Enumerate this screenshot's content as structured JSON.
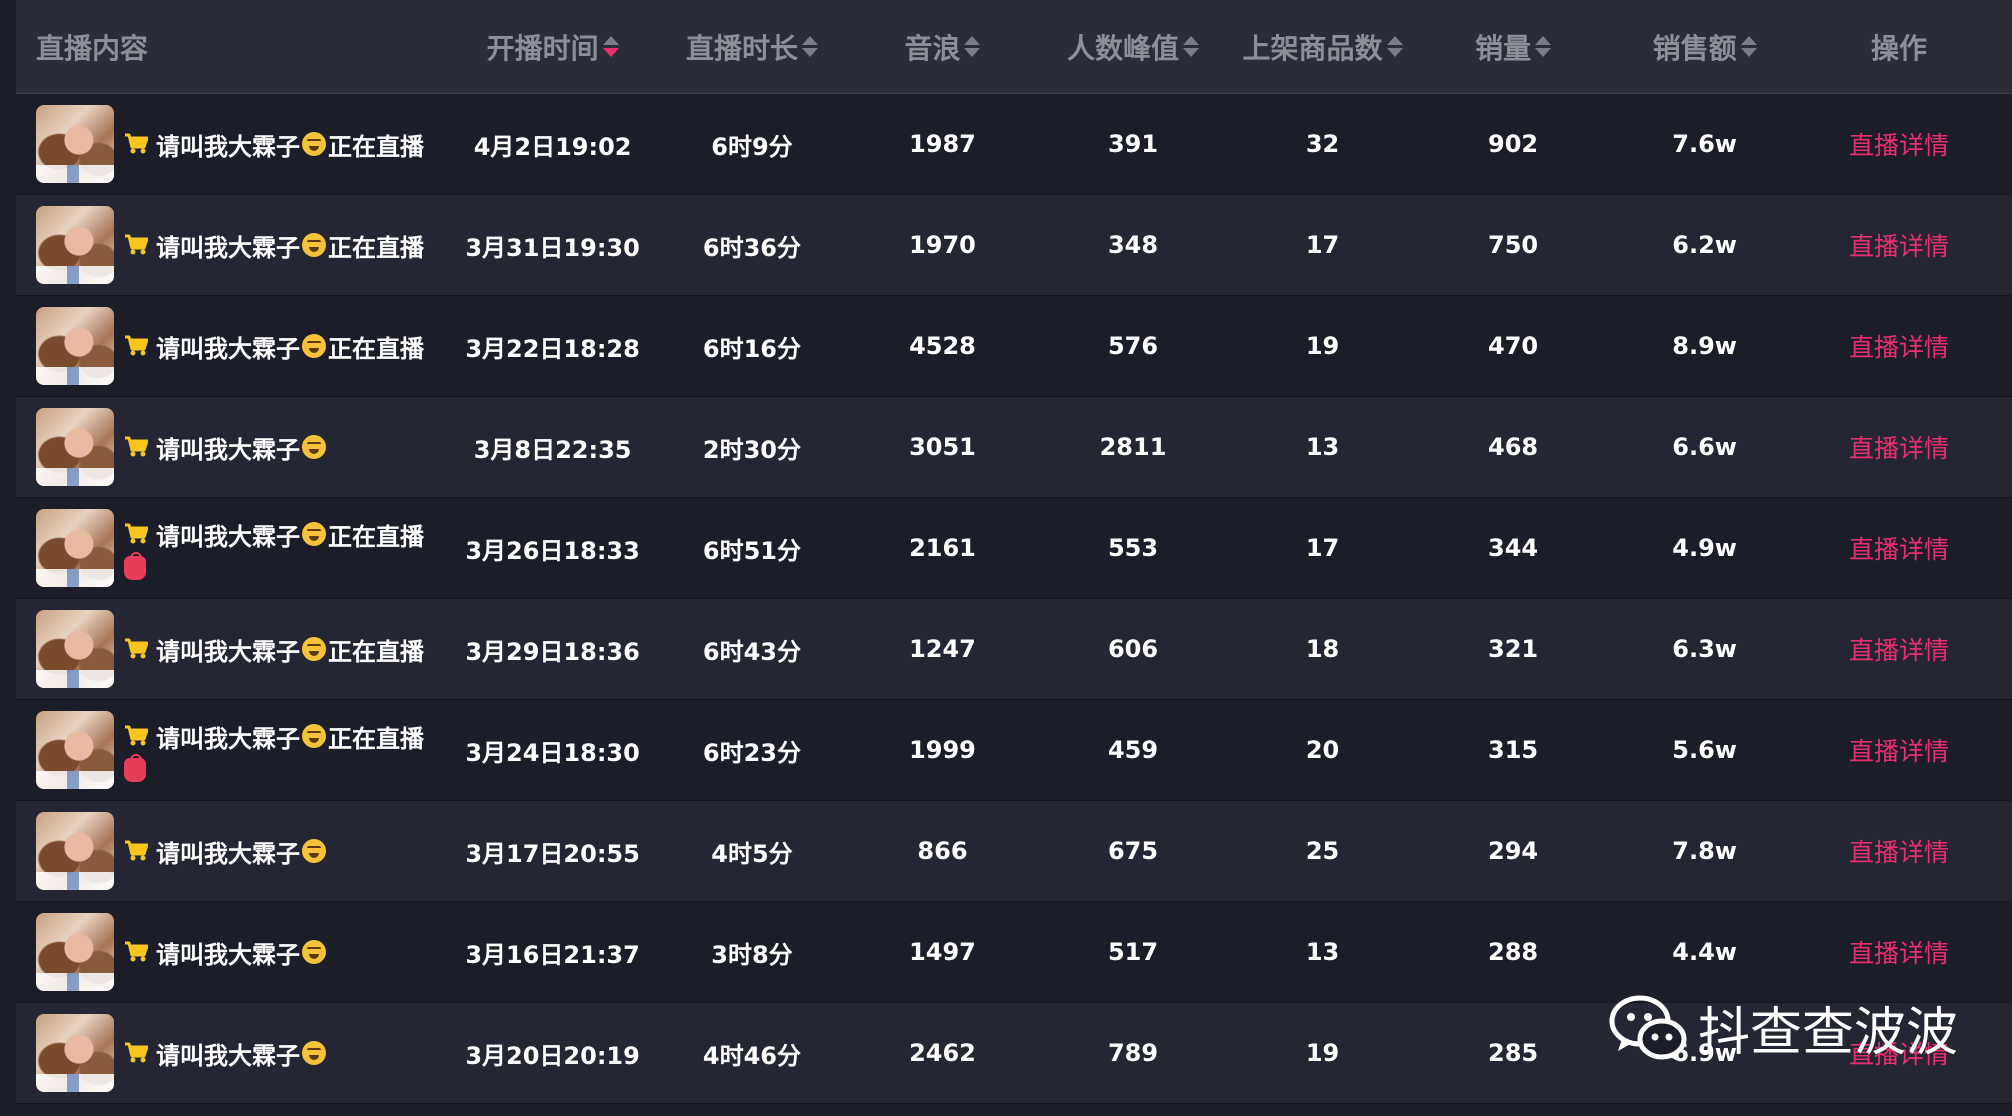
{
  "header": {
    "content": "直播内容",
    "start_time": "开播时间",
    "duration": "直播时长",
    "sound_wave": "音浪",
    "peak_viewers": "人数峰值",
    "products": "上架商品数",
    "sales": "销量",
    "revenue": "销售额",
    "action": "操作"
  },
  "rows": [
    {
      "title": "请叫我大霖子",
      "live": "正在直播",
      "bag": false,
      "time": "4月2日19:02",
      "duration": "6时9分",
      "wave": "1987",
      "peak": "391",
      "products": "32",
      "sales": "902",
      "revenue": "7.6w",
      "action": "直播详情"
    },
    {
      "title": "请叫我大霖子",
      "live": "正在直播",
      "bag": false,
      "time": "3月31日19:30",
      "duration": "6时36分",
      "wave": "1970",
      "peak": "348",
      "products": "17",
      "sales": "750",
      "revenue": "6.2w",
      "action": "直播详情"
    },
    {
      "title": "请叫我大霖子",
      "live": "正在直播",
      "bag": false,
      "time": "3月22日18:28",
      "duration": "6时16分",
      "wave": "4528",
      "peak": "576",
      "products": "19",
      "sales": "470",
      "revenue": "8.9w",
      "action": "直播详情"
    },
    {
      "title": "请叫我大霖子",
      "live": "",
      "bag": false,
      "time": "3月8日22:35",
      "duration": "2时30分",
      "wave": "3051",
      "peak": "2811",
      "products": "13",
      "sales": "468",
      "revenue": "6.6w",
      "action": "直播详情"
    },
    {
      "title": "请叫我大霖子",
      "live": "正在直播",
      "bag": true,
      "time": "3月26日18:33",
      "duration": "6时51分",
      "wave": "2161",
      "peak": "553",
      "products": "17",
      "sales": "344",
      "revenue": "4.9w",
      "action": "直播详情"
    },
    {
      "title": "请叫我大霖子",
      "live": "正在直播",
      "bag": false,
      "time": "3月29日18:36",
      "duration": "6时43分",
      "wave": "1247",
      "peak": "606",
      "products": "18",
      "sales": "321",
      "revenue": "6.3w",
      "action": "直播详情"
    },
    {
      "title": "请叫我大霖子",
      "live": "正在直播",
      "bag": true,
      "time": "3月24日18:30",
      "duration": "6时23分",
      "wave": "1999",
      "peak": "459",
      "products": "20",
      "sales": "315",
      "revenue": "5.6w",
      "action": "直播详情"
    },
    {
      "title": "请叫我大霖子",
      "live": "",
      "bag": false,
      "time": "3月17日20:55",
      "duration": "4时5分",
      "wave": "866",
      "peak": "675",
      "products": "25",
      "sales": "294",
      "revenue": "7.8w",
      "action": "直播详情"
    },
    {
      "title": "请叫我大霖子",
      "live": "",
      "bag": false,
      "time": "3月16日21:37",
      "duration": "3时8分",
      "wave": "1497",
      "peak": "517",
      "products": "13",
      "sales": "288",
      "revenue": "4.4w",
      "action": "直播详情"
    },
    {
      "title": "请叫我大霖子",
      "live": "",
      "bag": false,
      "time": "3月20日20:19",
      "duration": "4时46分",
      "wave": "2462",
      "peak": "789",
      "products": "19",
      "sales": "285",
      "revenue": "6.9w",
      "action": "直播详情"
    }
  ],
  "watermark": {
    "text": "抖查查波波",
    "icon": "wechat-icon"
  },
  "colors": {
    "accent": "#ea2e6d",
    "cart": "#f7c51e",
    "header_bg": "#2a2d38",
    "row_dark": "#1b1e29",
    "row_light": "#242733"
  },
  "icons": {
    "cart": "shopping-cart-icon",
    "emoji": "laughing-emoji-icon",
    "bag": "money-bag-icon",
    "sort": "sort-arrows-icon"
  }
}
